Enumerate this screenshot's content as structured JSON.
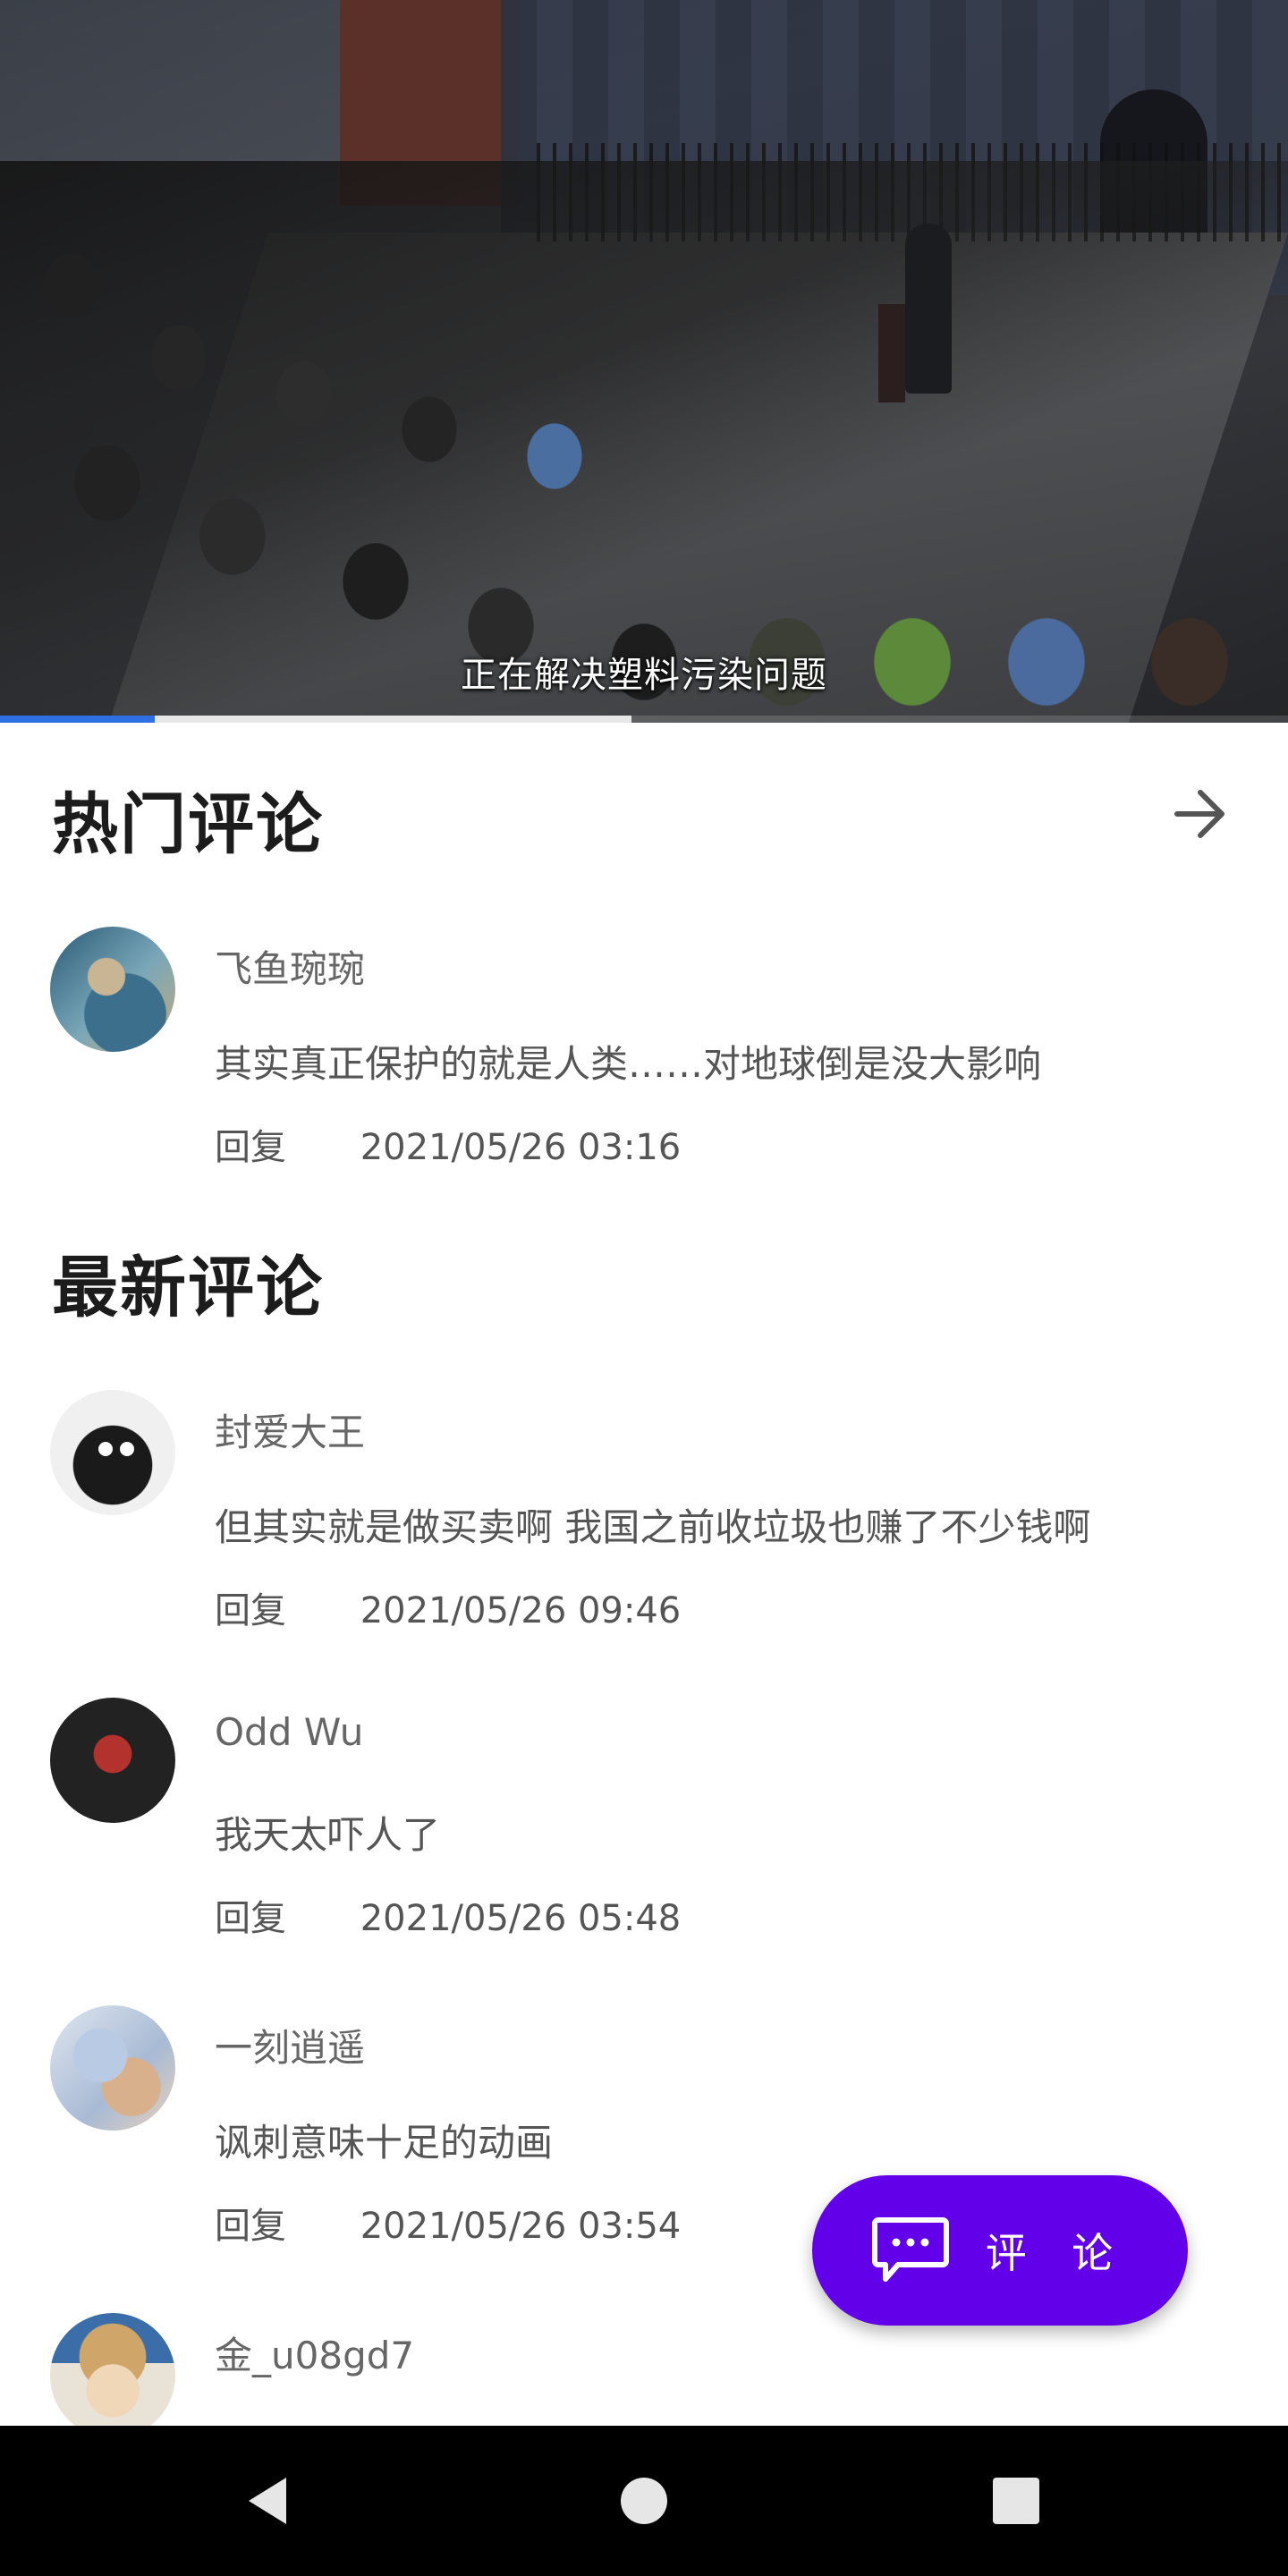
{
  "video": {
    "subtitle": "正在解决塑料污染问题",
    "progress_played": 0.12,
    "progress_buffered": 0.49
  },
  "hot_comments": {
    "title": "热门评论",
    "more_icon": "arrow-right-icon",
    "items": [
      {
        "name": "飞鱼琬琬",
        "text": "其实真正保护的就是人类……对地球倒是没大影响",
        "reply_label": "回复",
        "time": "2021/05/26 03:16"
      }
    ]
  },
  "latest_comments": {
    "title": "最新评论",
    "items": [
      {
        "name": "封爱大王",
        "text": "但其实就是做买卖啊 我国之前收垃圾也赚了不少钱啊",
        "reply_label": "回复",
        "time": "2021/05/26 09:46"
      },
      {
        "name": "Odd Wu",
        "text": "我天太吓人了",
        "reply_label": "回复",
        "time": "2021/05/26 05:48"
      },
      {
        "name": "一刻逍遥",
        "text": "讽刺意味十足的动画",
        "reply_label": "回复",
        "time": "2021/05/26 03:54"
      },
      {
        "name": "金_u08gd7"
      }
    ]
  },
  "fab": {
    "label": "评 论",
    "icon": "comment-icon",
    "color": "#6200ea"
  },
  "navbar": {
    "icons": [
      "back-icon",
      "home-icon",
      "recents-icon"
    ]
  }
}
